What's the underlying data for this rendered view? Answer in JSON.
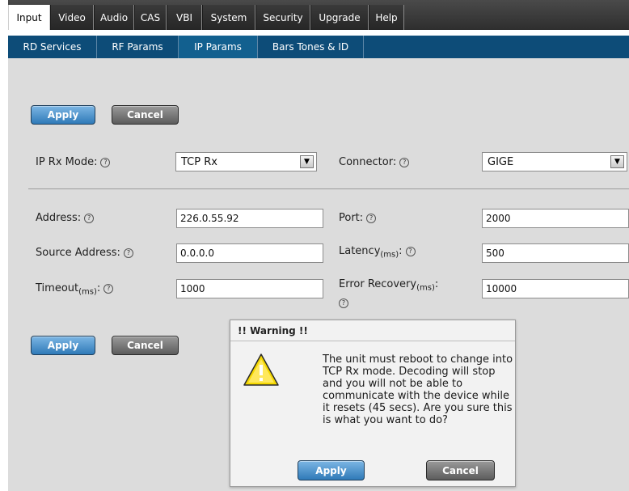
{
  "top_menu": {
    "items": [
      {
        "label": "Input"
      },
      {
        "label": "Video"
      },
      {
        "label": "Audio"
      },
      {
        "label": "CAS"
      },
      {
        "label": "VBI"
      },
      {
        "label": "System"
      },
      {
        "label": "Security"
      },
      {
        "label": "Upgrade"
      },
      {
        "label": "Help"
      }
    ],
    "active": "Input"
  },
  "sub_menu": {
    "items": [
      {
        "label": "RD Services"
      },
      {
        "label": "RF Params"
      },
      {
        "label": "IP Params"
      },
      {
        "label": "Bars Tones & ID"
      }
    ],
    "active": "IP Params"
  },
  "buttons": {
    "apply": "Apply",
    "cancel": "Cancel"
  },
  "help_glyph": "?",
  "form": {
    "ip_rx_mode": {
      "label": "IP Rx Mode:",
      "value": "TCP Rx"
    },
    "connector": {
      "label": "Connector:",
      "value": "GIGE"
    },
    "address": {
      "label": "Address:",
      "value": "226.0.55.92"
    },
    "port": {
      "label": "Port:",
      "value": "2000"
    },
    "source_address": {
      "label": "Source Address:",
      "value": "0.0.0.0"
    },
    "latency": {
      "label": "Latency",
      "unit": "(ms)",
      "suffix": ":",
      "value": "500"
    },
    "timeout": {
      "label": "Timeout",
      "unit": "(ms)",
      "suffix": ":",
      "value": "1000"
    },
    "error_recovery": {
      "label": "Error Recovery",
      "unit": "(ms)",
      "suffix": ":",
      "value": "10000"
    }
  },
  "dialog": {
    "title": "!! Warning !!",
    "message": "The unit must reboot to change into TCP Rx mode. Decoding will stop and you will not be able to communicate with the device while it resets (45 secs). Are you sure this is what you want to do?",
    "apply_label": "Apply",
    "cancel_label": "Cancel",
    "icon": "warning-icon",
    "icon_color": "#f5d800"
  },
  "colors": {
    "top_bar": "#333333",
    "sub_bar": "#0d4c78",
    "panel": "#dcdcdc",
    "apply_button": "#3a86c4"
  }
}
